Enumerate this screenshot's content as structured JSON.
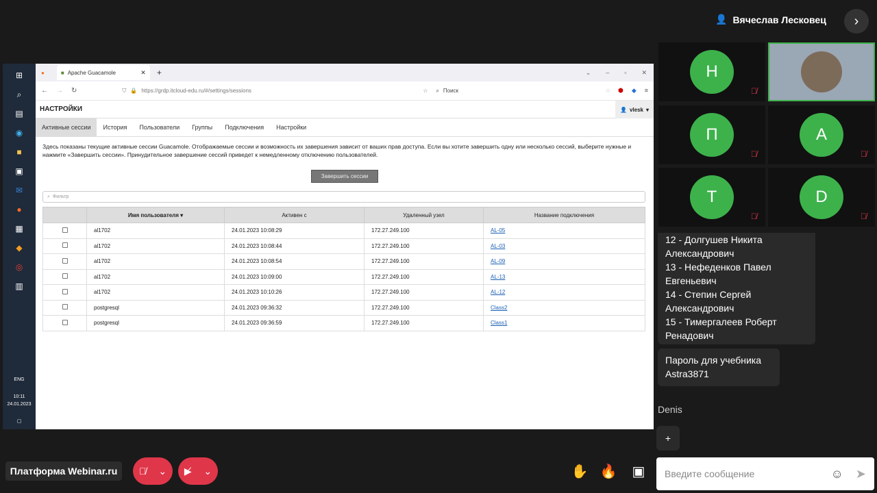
{
  "presenter": {
    "name": "Вячеслав Лесковец"
  },
  "browser": {
    "tab_title": "Apache Guacamole",
    "url": "https://grdp.itcloud-edu.ru/#/settings/sessions",
    "search_placeholder": "Поиск"
  },
  "guac": {
    "title": "НАСТРОЙКИ",
    "user": "vlesk",
    "tabs": [
      "Активные сессии",
      "История",
      "Пользователи",
      "Группы",
      "Подключения",
      "Настройки"
    ],
    "help_text": "Здесь показаны текущие активные сессии Guacamole. Отображаемые сессии и возможность их завершения зависит от ваших прав доступа. Если вы хотите завершить одну или несколько сессий, выберите нужные и нажмите «Завершить сессии». Принудительное завершение сессий приведет к немедленному отключению пользователей.",
    "end_button": "Завершить сессии",
    "filter_placeholder": "Фильтр",
    "columns": [
      "Имя пользователя",
      "Активен с",
      "Удаленный узел",
      "Название подключения"
    ],
    "rows": [
      {
        "user": "al1702",
        "since": "24.01.2023 10:08:29",
        "host": "172.27.249.100",
        "conn": "AL-05"
      },
      {
        "user": "al1702",
        "since": "24.01.2023 10:08:44",
        "host": "172.27.249.100",
        "conn": "AL-03"
      },
      {
        "user": "al1702",
        "since": "24.01.2023 10:08:54",
        "host": "172.27.249.100",
        "conn": "AL-09"
      },
      {
        "user": "al1702",
        "since": "24.01.2023 10:09:00",
        "host": "172.27.249.100",
        "conn": "AL-13"
      },
      {
        "user": "al1702",
        "since": "24.01.2023 10:10:26",
        "host": "172.27.249.100",
        "conn": "AL-12"
      },
      {
        "user": "postgresql",
        "since": "24.01.2023 09:36:32",
        "host": "172.27.249.100",
        "conn": "Class2"
      },
      {
        "user": "postgresql",
        "since": "24.01.2023 09:36:59",
        "host": "172.27.249.100",
        "conn": "Class1"
      }
    ]
  },
  "os": {
    "lang": "ENG",
    "time": "10:11",
    "date": "24.01.2023"
  },
  "participants": [
    "Н",
    "П",
    "А",
    "Т",
    "D"
  ],
  "chat": {
    "lines": [
      "12 - Долгушев Никита",
      "Александрович",
      "13 - Нефеденков Павел",
      "Евгеньевич",
      "14 - Степин Сергей",
      "Александрович",
      "15 - Тимергалеев Роберт",
      "Ренадович"
    ],
    "pass_line1": "Пароль для учебника",
    "pass_line2": "Astra3871",
    "author": "Denis",
    "input_placeholder": "Введите сообщение"
  },
  "brand": "Платформа Webinar.ru",
  "colors": {
    "accent_green": "#3db24b",
    "mic_red": "#e0364a"
  }
}
